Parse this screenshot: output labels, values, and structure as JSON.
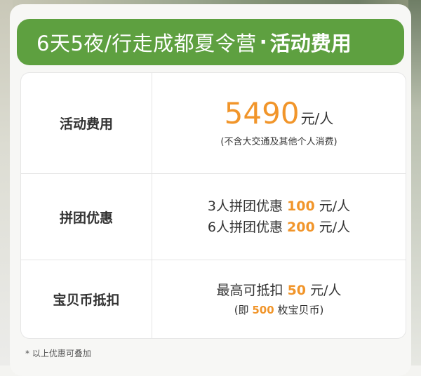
{
  "banner": {
    "title": "6天5夜/行走成都夏令营",
    "separator": "·",
    "subtitle": "活动费用"
  },
  "rows": [
    {
      "label": "活动费用",
      "price": "5490",
      "price_unit": "元/人",
      "note": "(不含大交通及其他个人消费)"
    },
    {
      "label": "拼团优惠",
      "line1_prefix": "3人拼团优惠",
      "line1_amount": "100",
      "line1_suffix": "元/人",
      "line2_prefix": "6人拼团优惠",
      "line2_amount": "200",
      "line2_suffix": "元/人"
    },
    {
      "label": "宝贝币抵扣",
      "line1_prefix": "最高可抵扣",
      "line1_amount": "50",
      "line1_suffix": "元/人",
      "line2_prefix": "(即",
      "line2_amount": "500",
      "line2_suffix": "枚宝贝币)"
    }
  ],
  "footnote": "* 以上优惠可叠加",
  "colors": {
    "banner": "#5ea040",
    "accent": "#f1952a"
  }
}
